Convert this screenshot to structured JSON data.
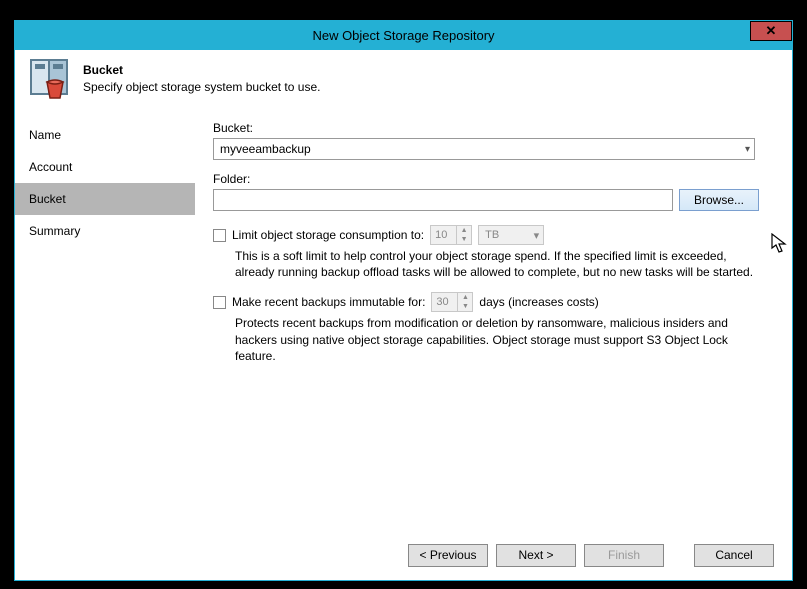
{
  "window": {
    "title": "New Object Storage Repository",
    "close_glyph": "✕"
  },
  "header": {
    "title": "Bucket",
    "desc": "Specify object storage system bucket to use."
  },
  "sidebar": {
    "steps": [
      "Name",
      "Account",
      "Bucket",
      "Summary"
    ],
    "active_index": 2
  },
  "content": {
    "bucket_label": "Bucket:",
    "bucket_value": "myveeambackup",
    "folder_label": "Folder:",
    "folder_value": "",
    "browse_label": "Browse...",
    "limit": {
      "label": "Limit object storage consumption to:",
      "value": "10",
      "unit": "TB",
      "help": "This is a soft limit to help control your object storage spend. If the specified limit is exceeded, already running backup offload tasks will be allowed to complete, but no new tasks will be started."
    },
    "immutable": {
      "label": "Make recent backups immutable for:",
      "value": "30",
      "suffix": "days (increases costs)",
      "help": "Protects recent backups from modification or deletion by ransomware, malicious insiders and hackers using native object storage capabilities. Object storage must support S3 Object Lock feature."
    }
  },
  "footer": {
    "prev": "< Previous",
    "next": "Next >",
    "finish": "Finish",
    "cancel": "Cancel"
  }
}
